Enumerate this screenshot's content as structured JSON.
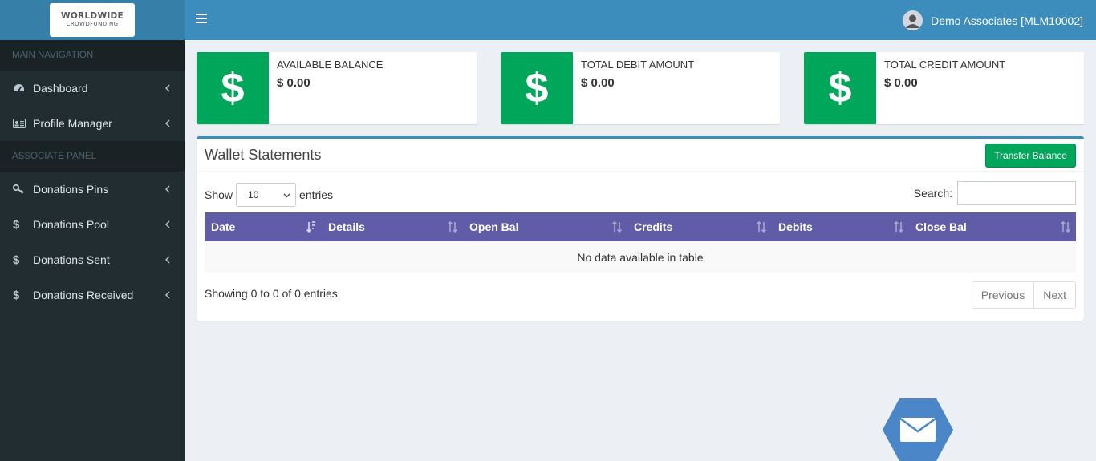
{
  "brand": {
    "line1": "WORLDWIDE",
    "line2": "CROWDFUNDING"
  },
  "header": {
    "user_name": "Demo Associates [MLM10002]"
  },
  "sidebar": {
    "main_header": "MAIN NAVIGATION",
    "main_items": [
      {
        "label": "Dashboard",
        "icon": "dashboard-icon"
      },
      {
        "label": "Profile Manager",
        "icon": "id-card-icon"
      }
    ],
    "panel_header": "ASSOCIATE PANEL",
    "panel_items": [
      {
        "label": "Donations Pins",
        "icon": "key-icon"
      },
      {
        "label": "Donations Pool",
        "icon": "dollar-icon"
      },
      {
        "label": "Donations Sent",
        "icon": "dollar-icon"
      },
      {
        "label": "Donations Received",
        "icon": "dollar-icon"
      }
    ]
  },
  "info_boxes": [
    {
      "label": "AVAILABLE BALANCE",
      "value": "$ 0.00",
      "icon": "$"
    },
    {
      "label": "TOTAL DEBIT AMOUNT",
      "value": "$ 0.00",
      "icon": "$"
    },
    {
      "label": "TOTAL CREDIT AMOUNT",
      "value": "$ 0.00",
      "icon": "$"
    }
  ],
  "wallet": {
    "title": "Wallet Statements",
    "transfer_label": "Transfer Balance",
    "show_label": "Show",
    "entries_select": "10",
    "entries_label": "entries",
    "search_label": "Search:",
    "columns": [
      "Date",
      "Details",
      "Open Bal",
      "Credits",
      "Debits",
      "Close Bal"
    ],
    "empty_text": "No data available in table",
    "showing_text": "Showing 0 to 0 of 0 entries",
    "prev_label": "Previous",
    "next_label": "Next"
  },
  "colors": {
    "primary": "#3c8dbc",
    "sidebar": "#222d32",
    "success": "#00a65a",
    "table_header": "#605ca8"
  }
}
